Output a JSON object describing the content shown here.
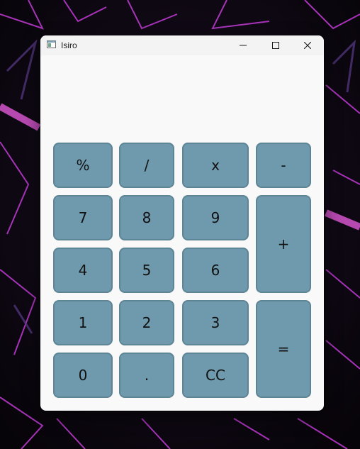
{
  "window": {
    "title": "Isiro"
  },
  "display": {
    "value": ""
  },
  "keys": {
    "percent": "%",
    "divide": "/",
    "multiply": "x",
    "minus": "-",
    "seven": "7",
    "eight": "8",
    "nine": "9",
    "plus": "+",
    "four": "4",
    "five": "5",
    "six": "6",
    "one": "1",
    "two": "2",
    "three": "3",
    "equals": "=",
    "zero": "0",
    "decimal": ".",
    "clear": "CC"
  },
  "colors": {
    "key_fill": "#6f9aad",
    "key_border": "#5d8596",
    "window_bg": "#f9f9f9"
  },
  "icons": {
    "app": "app-window-icon",
    "minimize": "minimize-icon",
    "maximize": "maximize-icon",
    "close": "close-icon"
  }
}
